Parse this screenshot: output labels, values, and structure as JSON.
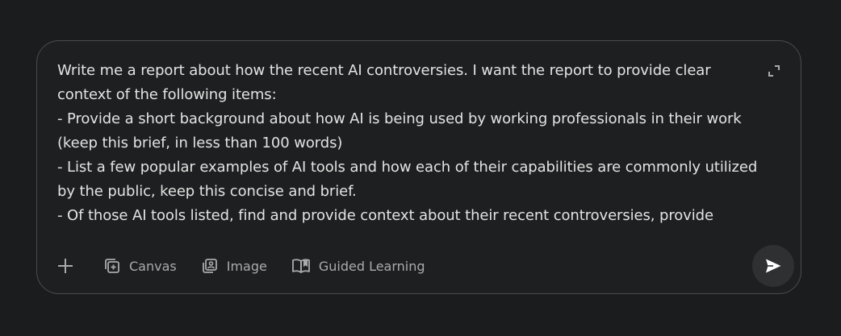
{
  "composer": {
    "prompt_text": "Write me a report about how the recent AI controversies. I want the report to provide clear context of the following items:\n- Provide a short background about how AI is being used by working professionals in their work (keep this brief, in less than 100 words)\n- List a few popular examples of AI tools and how each of their capabilities are commonly utilized by the public, keep this concise and brief.\n- Of those AI tools listed, find and provide context about their recent controversies, provide",
    "expand_icon": "expand-icon"
  },
  "toolbar": {
    "add_icon": "plus-icon",
    "tools": [
      {
        "label": "Canvas",
        "icon": "canvas-icon"
      },
      {
        "label": "Image",
        "icon": "image-icon"
      },
      {
        "label": "Guided Learning",
        "icon": "book-icon"
      }
    ],
    "send_icon": "send-icon"
  },
  "colors": {
    "background": "#1b1c1d",
    "composer_bg": "#1e1f20",
    "border": "#4a4c4f",
    "text": "#e3e3e3",
    "muted": "#a8abad",
    "send_bg": "#2f3032"
  }
}
